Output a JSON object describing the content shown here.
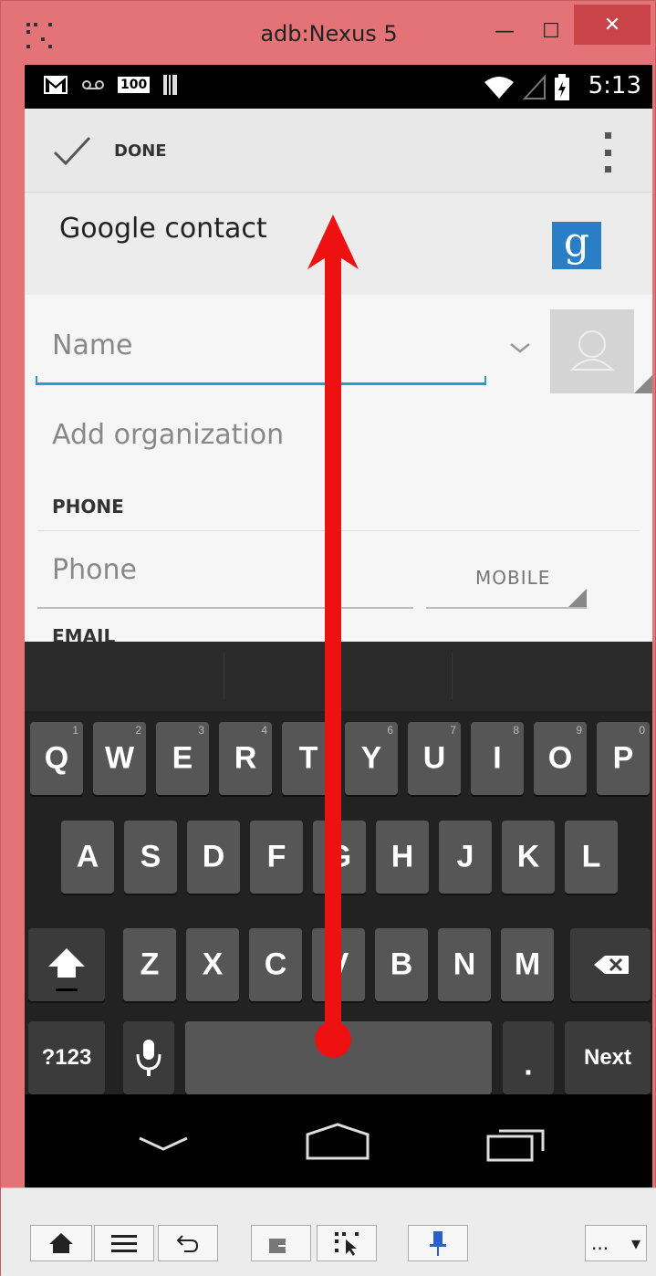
{
  "window": {
    "title": "adb:Nexus 5",
    "min_glyph": "—",
    "max_glyph": "☐",
    "close_glyph": "✕"
  },
  "status_bar": {
    "time": "5:13",
    "battery_text": "100",
    "icons": [
      "gmail-icon",
      "voicemail-icon",
      "battery-100-icon",
      "barcode-icon",
      "wifi-icon",
      "signal-icon",
      "battery-charging-icon"
    ]
  },
  "action_bar": {
    "done_label": "DONE",
    "overflow_icon": "overflow-menu-icon"
  },
  "account": {
    "label": "Google contact",
    "logo_glyph": "g"
  },
  "form": {
    "name_placeholder": "Name",
    "organization_placeholder": "Add organization",
    "phone_header": "PHONE",
    "phone_placeholder": "Phone",
    "phone_type": "MOBILE",
    "email_header_partial": "EMAIL"
  },
  "keyboard": {
    "row1": [
      {
        "key": "Q",
        "sub": "1"
      },
      {
        "key": "W",
        "sub": "2"
      },
      {
        "key": "E",
        "sub": "3"
      },
      {
        "key": "R",
        "sub": "4"
      },
      {
        "key": "T",
        "sub": "5"
      },
      {
        "key": "Y",
        "sub": "6"
      },
      {
        "key": "U",
        "sub": "7"
      },
      {
        "key": "I",
        "sub": "8"
      },
      {
        "key": "O",
        "sub": "9"
      },
      {
        "key": "P",
        "sub": "0"
      }
    ],
    "row2": [
      "A",
      "S",
      "D",
      "F",
      "G",
      "H",
      "J",
      "K",
      "L"
    ],
    "row3": [
      "Z",
      "X",
      "C",
      "V",
      "B",
      "N",
      "M"
    ],
    "symbols_label": "?123",
    "period_label": ".",
    "next_label": "Next"
  },
  "nav_bar": {
    "icons": [
      "back-icon",
      "home-icon",
      "recents-icon"
    ]
  },
  "bottom_toolbar": {
    "more_label": "...",
    "dropdown_glyph": "▾"
  },
  "colors": {
    "window_frame": "#e37376",
    "close_button": "#c94449",
    "accent_line": "#2f9bc8",
    "google_blue": "#2a7ec6",
    "annotation_arrow": "#ee1111",
    "key_bg": "#565656"
  }
}
